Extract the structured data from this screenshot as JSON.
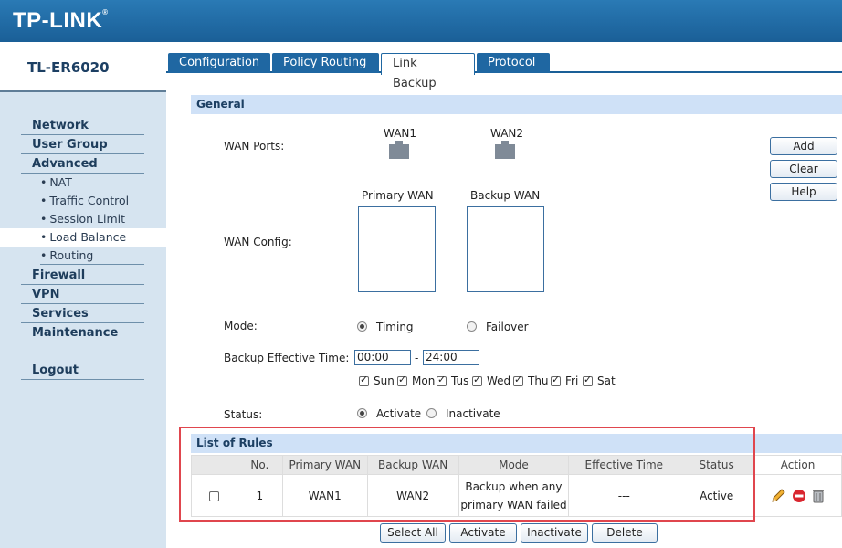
{
  "brand": {
    "logo": "TP-LINK",
    "model": "TL-ER6020"
  },
  "sidebar": {
    "network": "Network",
    "user_group": "User Group",
    "advanced": "Advanced",
    "nat": "NAT",
    "traffic_control": "Traffic Control",
    "session_limit": "Session Limit",
    "load_balance": "Load Balance",
    "routing": "Routing",
    "firewall": "Firewall",
    "vpn": "VPN",
    "services": "Services",
    "maintenance": "Maintenance",
    "logout": "Logout"
  },
  "tabs": {
    "configuration": "Configuration",
    "policy_routing": "Policy Routing",
    "link_backup": "Link Backup",
    "protocol": "Protocol"
  },
  "general": {
    "title": "General",
    "wan_ports_label": "WAN Ports:",
    "wan1": "WAN1",
    "wan2": "WAN2",
    "primary_wan": "Primary WAN",
    "backup_wan": "Backup WAN",
    "wan_config_label": "WAN Config:",
    "mode_label": "Mode:",
    "timing": "Timing",
    "failover": "Failover",
    "backup_time_label": "Backup Effective Time:",
    "time_start": "00:00",
    "time_sep": "-",
    "time_end": "24:00",
    "days": {
      "sun": "Sun",
      "mon": "Mon",
      "tue": "Tus",
      "wed": "Wed",
      "thu": "Thu",
      "fri": "Fri",
      "sat": "Sat"
    },
    "status_label": "Status:",
    "activate": "Activate",
    "inactivate": "Inactivate"
  },
  "side_buttons": {
    "add": "Add",
    "clear": "Clear",
    "help": "Help"
  },
  "rules": {
    "title": "List of Rules",
    "columns": {
      "no": "No.",
      "primary": "Primary WAN",
      "backup": "Backup WAN",
      "mode": "Mode",
      "time": "Effective Time",
      "status": "Status",
      "action": "Action"
    },
    "row": {
      "no": "1",
      "primary": "WAN1",
      "backup": "WAN2",
      "mode_line1": "Backup when any",
      "mode_line2": "primary WAN failed",
      "time": "---",
      "status": "Active"
    }
  },
  "bottom_buttons": {
    "select_all": "Select All",
    "activate": "Activate",
    "inactivate": "Inactivate",
    "delete": "Delete"
  }
}
